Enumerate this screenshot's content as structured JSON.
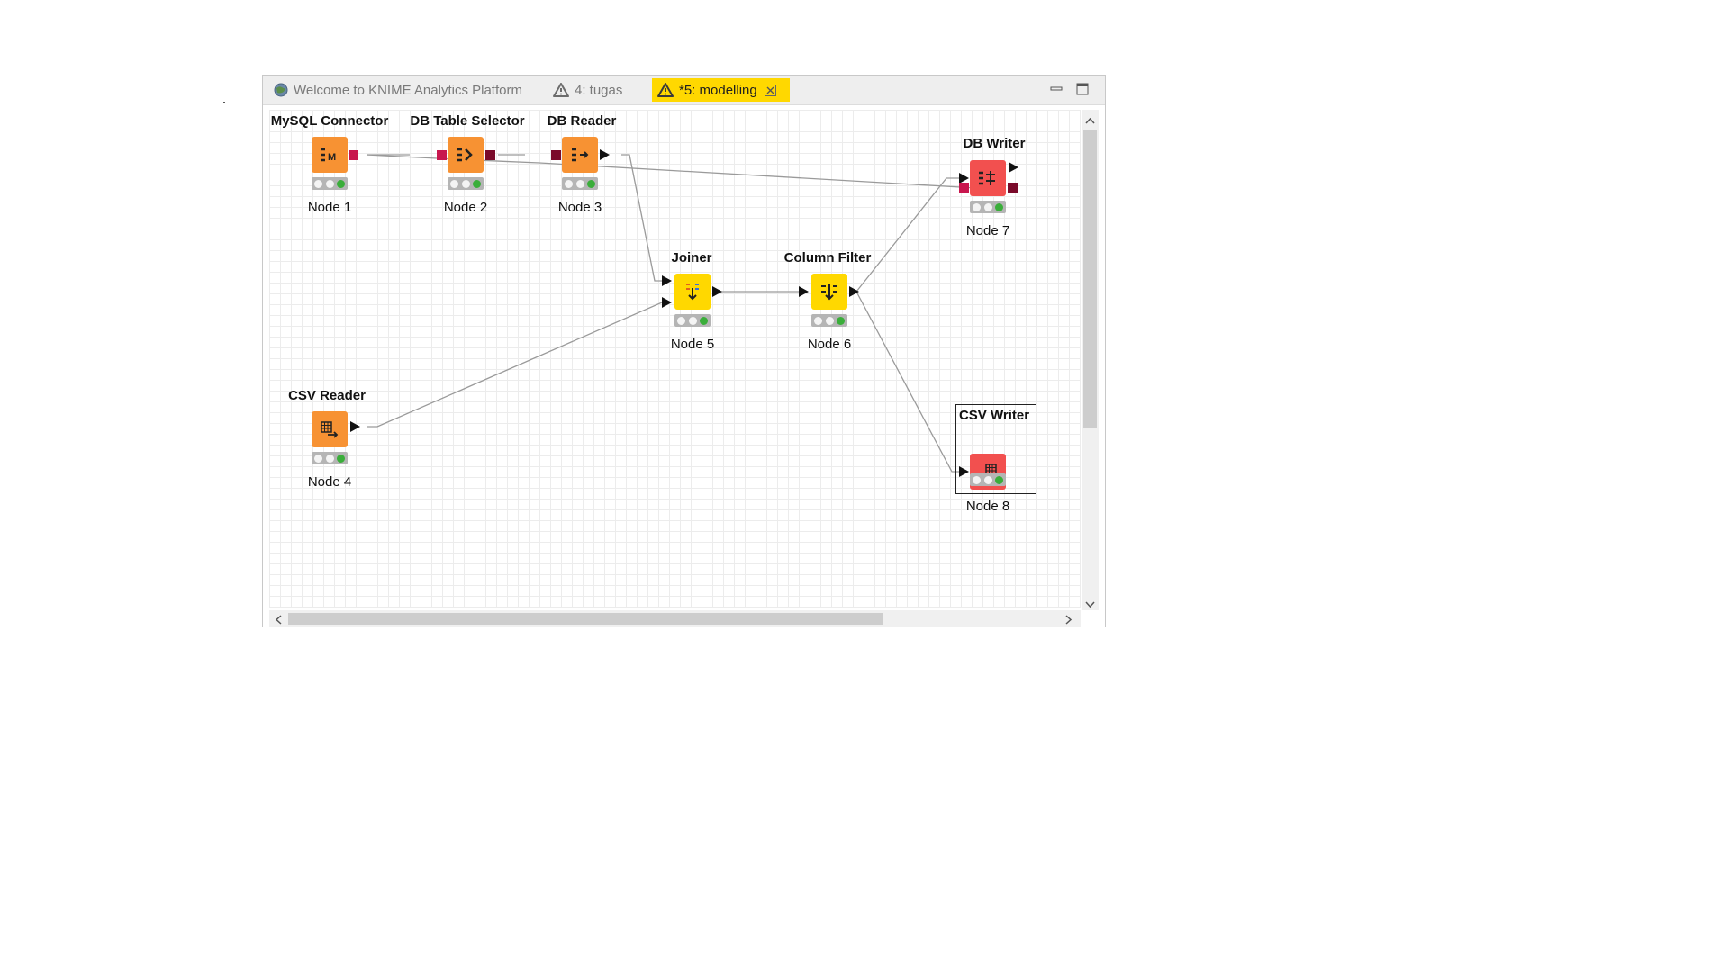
{
  "tabs": [
    {
      "label": "Welcome to KNIME Analytics Platform",
      "icon": "globe-icon"
    },
    {
      "label": "4: tugas",
      "icon": "warning-icon"
    },
    {
      "label": "*5: modelling",
      "icon": "warning-icon",
      "active": true,
      "close_icon": "close-icon"
    }
  ],
  "window_controls": {
    "minimize_icon": "minimize-icon",
    "maximize_icon": "maximize-icon"
  },
  "nodes": {
    "n1": {
      "title": "MySQL Connector",
      "label": "Node 1",
      "color": "#f79233",
      "icon": "mysql-connector-icon"
    },
    "n2": {
      "title": "DB Table Selector",
      "label": "Node 2",
      "color": "#f79233",
      "icon": "db-table-selector-icon"
    },
    "n3": {
      "title": "DB Reader",
      "label": "Node 3",
      "color": "#f79233",
      "icon": "db-reader-icon"
    },
    "n4": {
      "title": "CSV Reader",
      "label": "Node 4",
      "color": "#f79233",
      "icon": "csv-reader-icon"
    },
    "n5": {
      "title": "Joiner",
      "label": "Node 5",
      "color": "#ffd800",
      "icon": "joiner-icon"
    },
    "n6": {
      "title": "Column Filter",
      "label": "Node 6",
      "color": "#ffd800",
      "icon": "column-filter-icon"
    },
    "n7": {
      "title": "DB Writer",
      "label": "Node 7",
      "color": "#f2504f",
      "icon": "db-writer-icon"
    },
    "n8": {
      "title": "CSV Writer",
      "label": "Node 8",
      "color": "#f2504f",
      "icon": "csv-writer-icon",
      "selected": true
    }
  },
  "status": {
    "executed_light": "#3aae3a",
    "db_port_color": "#c8174e",
    "db_port_dark": "#7a0a2a",
    "link_color": "#9a9a9a"
  }
}
